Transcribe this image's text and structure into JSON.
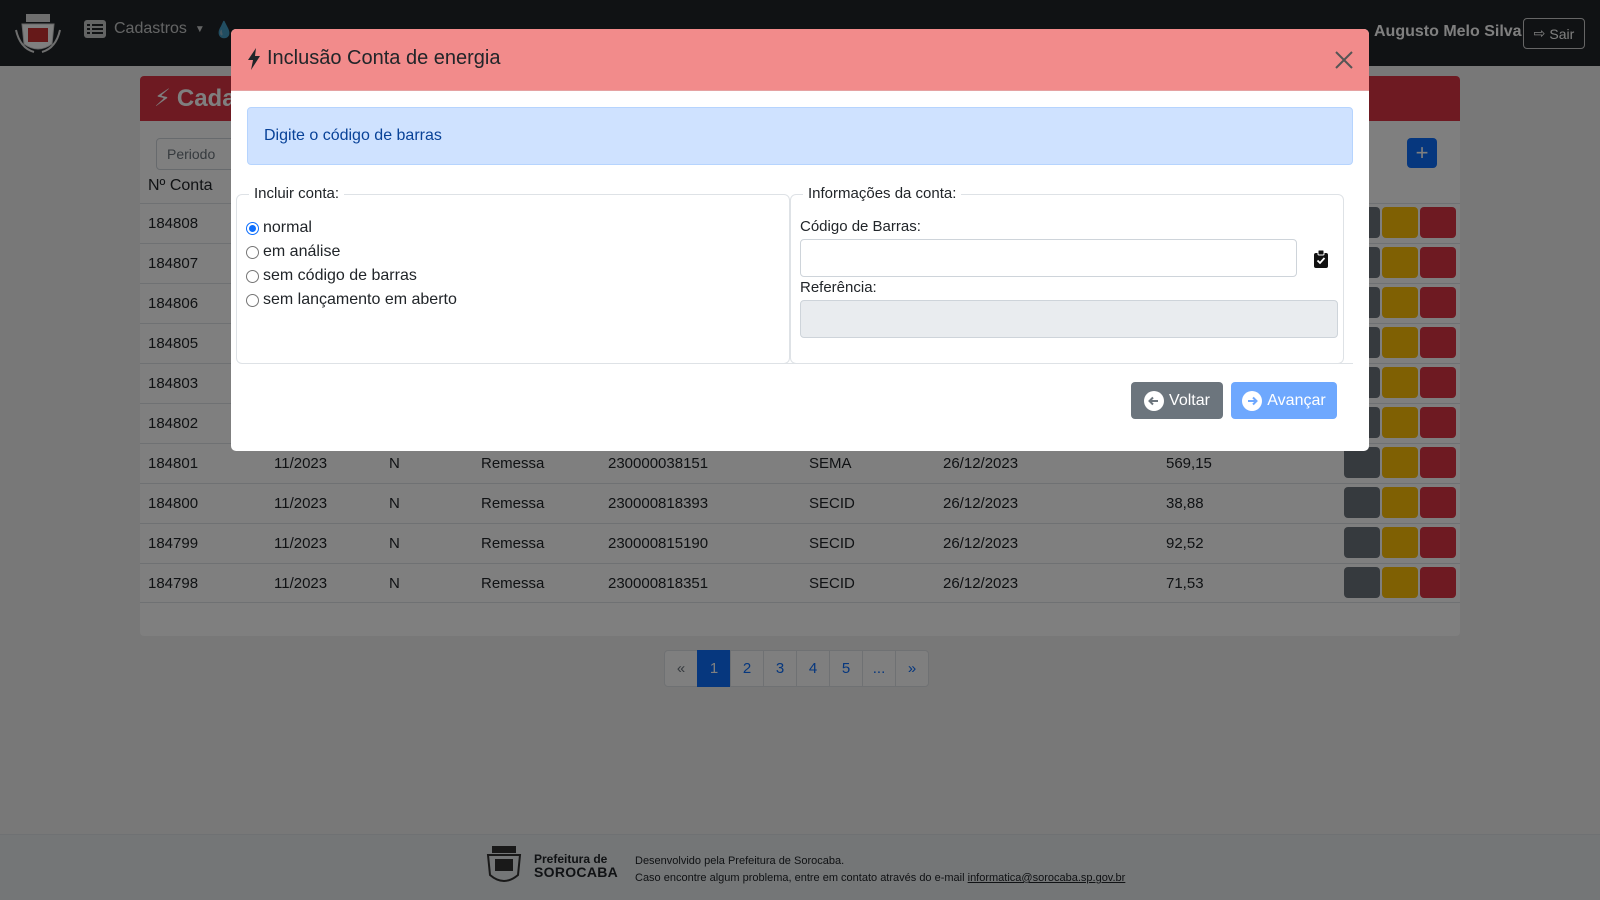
{
  "navbar": {
    "menu_cadastros": "Cadastros",
    "user_name": "Augusto Melo Silva",
    "logout_label": "Sair"
  },
  "page": {
    "card_title": "Cada",
    "filter_placeholder": "Periodo",
    "add_label": "+",
    "col_conta": "Nº Conta",
    "rows": [
      {
        "conta": "184808"
      },
      {
        "conta": "184807"
      },
      {
        "conta": "184806"
      },
      {
        "conta": "184805"
      },
      {
        "conta": "184803"
      },
      {
        "conta": "184802"
      },
      {
        "conta": "184801",
        "periodo": "11/2023",
        "tipo": "N",
        "situacao": "Remessa",
        "codigo": "230000038151",
        "orgao": "SEMA",
        "data": "26/12/2023",
        "valor": "569,15"
      },
      {
        "conta": "184800",
        "periodo": "11/2023",
        "tipo": "N",
        "situacao": "Remessa",
        "codigo": "230000818393",
        "orgao": "SECID",
        "data": "26/12/2023",
        "valor": "38,88"
      },
      {
        "conta": "184799",
        "periodo": "11/2023",
        "tipo": "N",
        "situacao": "Remessa",
        "codigo": "230000815190",
        "orgao": "SECID",
        "data": "26/12/2023",
        "valor": "92,52"
      },
      {
        "conta": "184798",
        "periodo": "11/2023",
        "tipo": "N",
        "situacao": "Remessa",
        "codigo": "230000818351",
        "orgao": "SECID",
        "data": "26/12/2023",
        "valor": "71,53"
      }
    ],
    "pagination": [
      "«",
      "1",
      "2",
      "3",
      "4",
      "5",
      "...",
      "»"
    ],
    "active_page": "1"
  },
  "footer": {
    "logo_line1": "Prefeitura de",
    "logo_line2": "SOROCABA",
    "line1": "Desenvolvido pela Prefeitura de Sorocaba.",
    "line2_prefix": "Caso encontre algum problema, entre em contato através do e-mail ",
    "email": "informatica@sorocaba.sp.gov.br"
  },
  "modal": {
    "title": "Inclusão Conta de energia",
    "alert": "Digite o código de barras",
    "incluir_legend": "Incluir conta:",
    "options": [
      "normal",
      "em análise",
      "sem código de barras",
      "sem lançamento em aberto"
    ],
    "selected_option": "normal",
    "info_legend": "Informações da conta:",
    "barcode_label": "Código de Barras:",
    "barcode_value": "",
    "ref_label": "Referência:",
    "ref_value": "",
    "btn_voltar": "Voltar",
    "btn_avancar": "Avançar"
  },
  "colors": {
    "modal_header": "#f28b8b",
    "alert_bg": "#cfe2ff",
    "primary": "#0d6efd",
    "danger": "#dc3545",
    "warning": "#ffc107",
    "secondary": "#6c757d"
  }
}
